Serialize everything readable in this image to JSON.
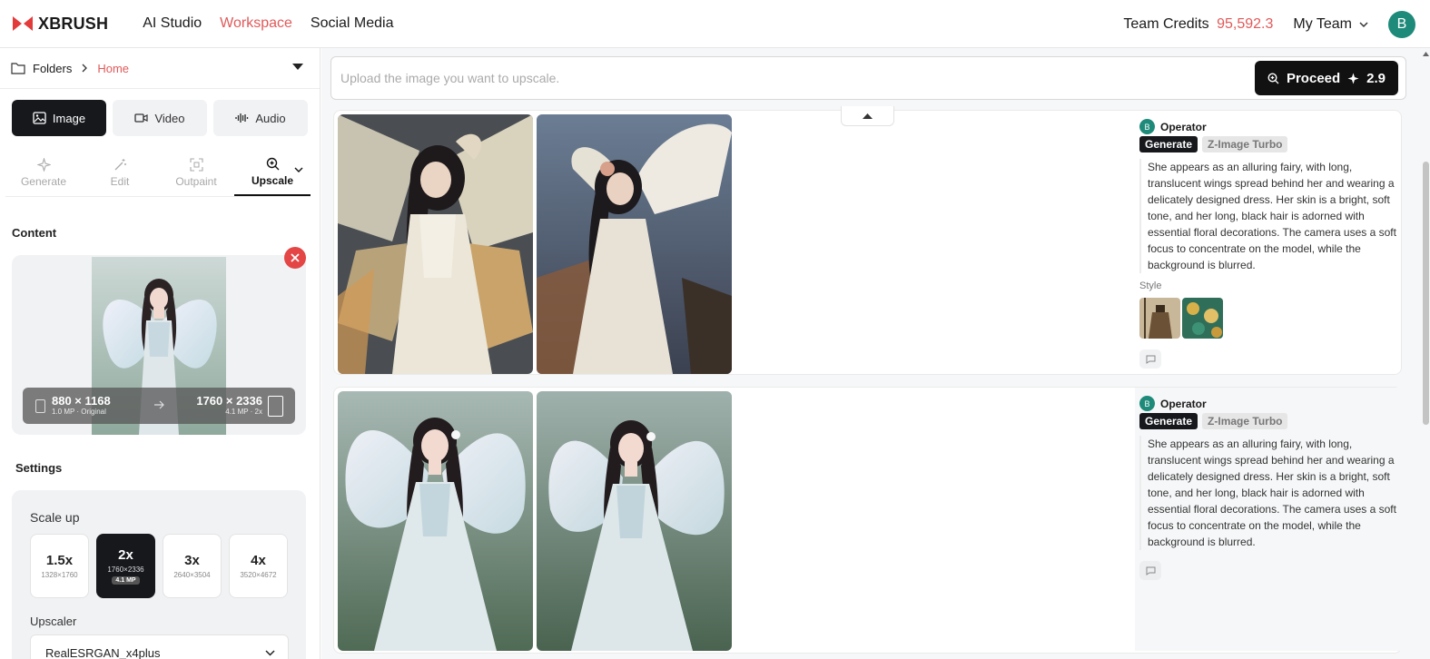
{
  "brand": {
    "name": "XBRUSH",
    "accent": "#e05a5a"
  },
  "nav": [
    "AI Studio",
    "Workspace",
    "Social Media"
  ],
  "nav_active": "Workspace",
  "header": {
    "credits_label": "Team Credits",
    "credits_value": "95,592.3",
    "team": "My Team",
    "avatar": "B"
  },
  "breadcrumb": {
    "folders": "Folders",
    "current": "Home"
  },
  "mode_tabs": [
    {
      "label": "Image",
      "icon": "image-icon",
      "active": true
    },
    {
      "label": "Video",
      "icon": "video-icon",
      "active": false
    },
    {
      "label": "Audio",
      "icon": "audio-icon",
      "active": false
    }
  ],
  "sub_tabs": [
    {
      "label": "Generate",
      "icon": "sparkle-icon",
      "active": false
    },
    {
      "label": "Edit",
      "icon": "magic-wand-icon",
      "active": false
    },
    {
      "label": "Outpaint",
      "icon": "expand-icon",
      "active": false
    },
    {
      "label": "Upscale",
      "icon": "zoom-in-icon",
      "active": true
    }
  ],
  "content": {
    "title": "Content",
    "original_size": "880 × 1168",
    "original_meta": "1.0 MP · Original",
    "target_size": "1760 × 2336",
    "target_meta": "4.1 MP · 2x"
  },
  "settings": {
    "title": "Settings",
    "scale_label": "Scale up",
    "scale_options": [
      {
        "value": "1.5x",
        "dims": "1328×1760",
        "mp": "",
        "active": false
      },
      {
        "value": "2x",
        "dims": "1760×2336",
        "mp": "4.1 MP",
        "active": true
      },
      {
        "value": "3x",
        "dims": "2640×3504",
        "mp": "",
        "active": false
      },
      {
        "value": "4x",
        "dims": "3520×4672",
        "mp": "",
        "active": false
      }
    ],
    "upscaler_label": "Upscaler",
    "upscaler_value": "RealESRGAN_x4plus"
  },
  "upload": {
    "placeholder": "Upload the image you want to upscale.",
    "proceed_label": "Proceed",
    "cost": "2.9"
  },
  "cards": [
    {
      "operator": "Operator",
      "avatar": "B",
      "tag": "Generate",
      "model": "Z-Image Turbo",
      "prompt": "She appears as an alluring fairy, with long, translucent wings spread behind her and wearing a delicately designed dress. Her skin is a bright, soft tone, and her long, black hair is adorned with essential floral decorations. The camera uses a soft focus to concentrate on the model, while the background is blurred.",
      "style_label": "Style"
    },
    {
      "operator": "Operator",
      "avatar": "B",
      "tag": "Generate",
      "model": "Z-Image Turbo",
      "prompt": "She appears as an alluring fairy, with long, translucent wings spread behind her and wearing a delicately designed dress. Her skin is a bright, soft tone, and her long, black hair is adorned with essential floral decorations. The camera uses a soft focus to concentrate on the model, while the background is blurred."
    }
  ]
}
